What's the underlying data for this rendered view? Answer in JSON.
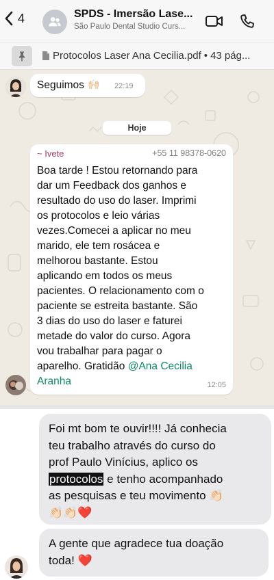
{
  "header": {
    "back_count": "4",
    "title": "SPDS - Imersão Lase...",
    "subtitle": "São Paulo Dental Studio Curs..."
  },
  "pinned": {
    "file_name": "Protocolos Laser Ana Cecilia.pdf",
    "separator": "•",
    "pages": "43 pág..."
  },
  "messages": {
    "prev": {
      "text": "Seguimos",
      "emoji": "🙌🏻",
      "time": "22:19"
    },
    "date_chip": "Hoje",
    "ivete": {
      "sender": "~ Ivete",
      "phone": "+55 11 98378-0620",
      "body": "Boa tarde ! Estou retornando para\ndar um Feedback dos ganhos e\nresultado do uso do laser. Imprimi\nos protocolos e leio várias\nvezes.Comecei a aplicar no meu\nmarido, ele tem rosácea e\nmelhorou bastante. Estou\naplicando em todos os meus\npacientes. O relacionamento com o\npaciente se estreita bastante. São\n3 dias do uso do laser e faturei\nmetade do valor do curso. Agora\nvou trabalhar para pagar o\naparelho. Gratidão ",
      "mention_1": "@Ana Cecilia",
      "mention_2": "Aranha",
      "time": "12:05"
    },
    "reply1": {
      "line1": "Foi mt bom te ouvir!!!! Já conhecia",
      "line2": "teu trabalho através do curso do",
      "line3": "prof Paulo Vinícius, aplico os",
      "highlight": "protocolos",
      "line4_rest": " e tenho acompanhado",
      "line5": "as pesquisas e teu movimento ",
      "emoji_line5": "👏🏻",
      "emoji_line6": "👏🏻👏🏻❤️"
    },
    "reply2": {
      "line1": "A gente que agradece tua doação",
      "line2": "toda! ",
      "emoji": "❤️"
    }
  }
}
